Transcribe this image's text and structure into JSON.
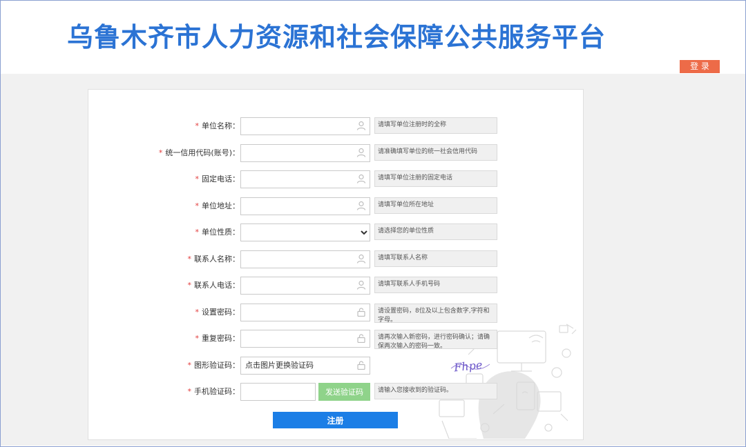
{
  "header": {
    "title": "乌鲁木齐市人力资源和社会保障公共服务平台",
    "login_label": "登 录"
  },
  "form": {
    "rows": [
      {
        "label": "单位名称：",
        "value": "",
        "hint": "请填写单位注册时的全称",
        "icon": "user-icon"
      },
      {
        "label": "统一信用代码(账号)：",
        "value": "",
        "hint": "请准确填写单位的统一社会信用代码",
        "icon": "user-icon"
      },
      {
        "label": "固定电话：",
        "value": "",
        "hint": "请填写单位注册的固定电话",
        "icon": "user-icon"
      },
      {
        "label": "单位地址：",
        "value": "",
        "hint": "请填写单位所在地址",
        "icon": "user-icon"
      },
      {
        "label": "单位性质：",
        "value": "",
        "hint": "请选择您的单位性质",
        "icon": "chevron-down-icon"
      },
      {
        "label": "联系人名称：",
        "value": "",
        "hint": "请填写联系人名称",
        "icon": "user-icon"
      },
      {
        "label": "联系人电话：",
        "value": "",
        "hint": "请填写联系人手机号码",
        "icon": "user-icon"
      },
      {
        "label": "设置密码：",
        "value": "",
        "hint": "请设置密码，8位及以上包含数字,字符和字母。",
        "icon": "lock-icon"
      },
      {
        "label": "重复密码：",
        "value": "",
        "hint": "请再次输入新密码，进行密码确认；请确保两次输入的密码一致。",
        "icon": "lock-icon"
      },
      {
        "label": "图形验证码：",
        "value": "点击图片更换验证码",
        "hint": "",
        "icon": "lock-icon"
      },
      {
        "label": "手机验证码：",
        "value": "",
        "hint": "请输入您接收到的验证码。",
        "icon": ""
      }
    ],
    "captcha_text": "Fhpe",
    "sms_button_label": "发送验证码",
    "submit_label": "注册"
  },
  "colors": {
    "title": "#2b73d4",
    "login": "#ed6b48",
    "sms_button": "#8fd38a",
    "submit": "#1b7ee6",
    "required": "#e23b3b"
  }
}
